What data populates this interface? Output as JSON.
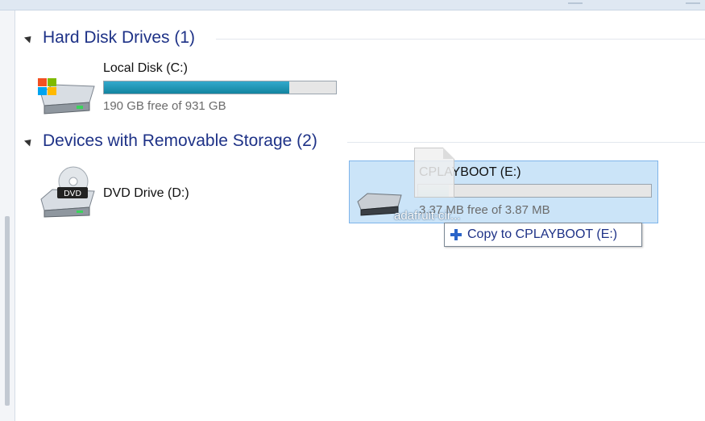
{
  "groups": [
    {
      "header": "Hard Disk Drives (1)"
    },
    {
      "header": "Devices with Removable Storage (2)"
    }
  ],
  "drives": {
    "local_disk": {
      "name": "Local Disk (C:)",
      "free_text": "190 GB free of 931 GB",
      "used_fraction": 0.8,
      "icon": "hard-drive-windows-icon"
    },
    "dvd": {
      "name": "DVD Drive (D:)",
      "icon": "dvd-drive-icon"
    },
    "usb": {
      "name": "CPLAYBOOT (E:)",
      "free_text": "3.37 MB free of 3.87 MB",
      "used_fraction": 0.13,
      "icon": "removable-drive-icon"
    }
  },
  "drag": {
    "ghost_file_label": "adafruit-cir...",
    "tooltip_text": "Copy to CPLAYBOOT (E:)"
  },
  "colors": {
    "header": "#1e3287",
    "bar_fill": "#1a93b5",
    "selection": "#cbe4f8"
  }
}
